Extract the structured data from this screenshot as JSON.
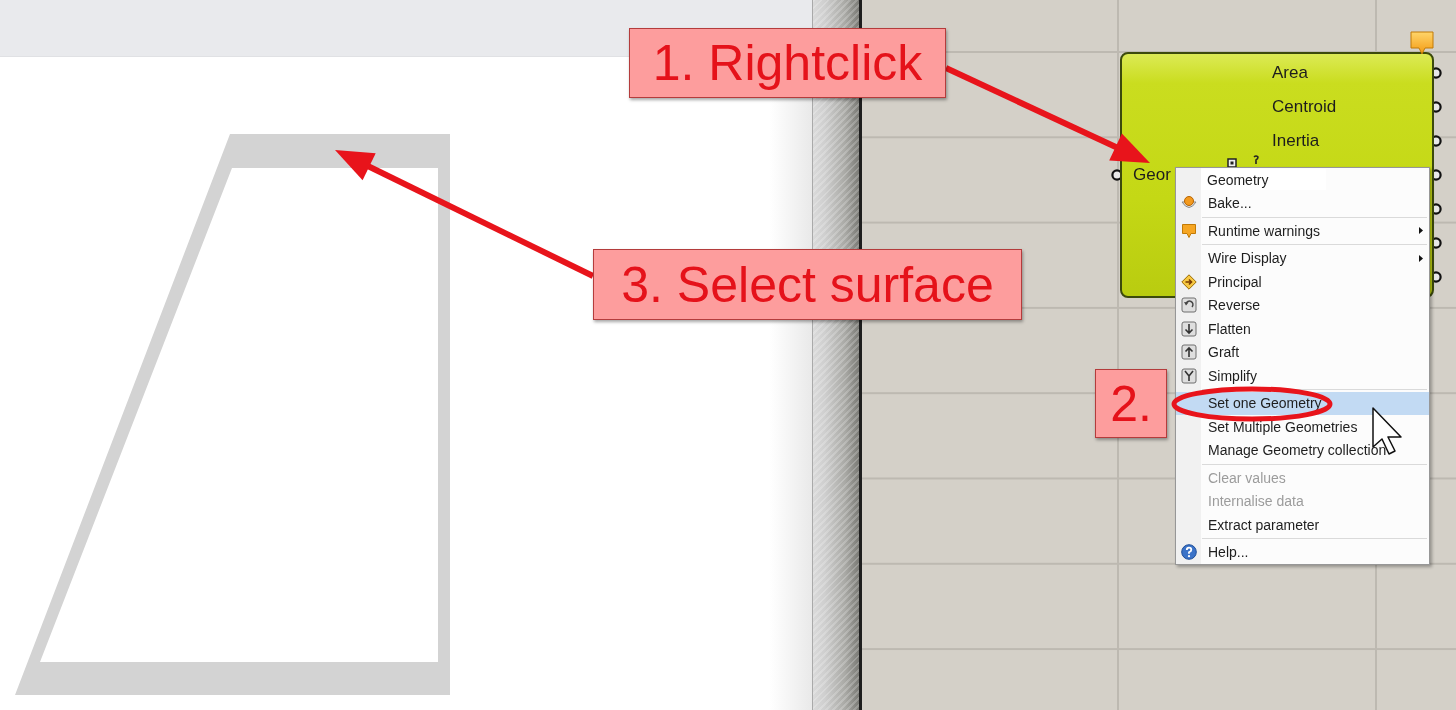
{
  "component": {
    "has_warning": true,
    "input": "Geor",
    "outputs": [
      "Area",
      "Centroid",
      "Inertia"
    ]
  },
  "context_menu": {
    "name_field": {
      "value": "Geometry"
    },
    "sections": [
      [
        {
          "label": "Bake...",
          "selected": false,
          "disabled": false,
          "submenu": false
        }
      ],
      [
        {
          "label": "Runtime warnings",
          "selected": false,
          "disabled": false,
          "submenu": true
        }
      ],
      [
        {
          "label": "Wire Display",
          "selected": false,
          "disabled": false,
          "submenu": true
        },
        {
          "label": "Principal",
          "selected": false,
          "disabled": false,
          "submenu": false
        },
        {
          "label": "Reverse",
          "selected": false,
          "disabled": false,
          "submenu": false
        },
        {
          "label": "Flatten",
          "selected": false,
          "disabled": false,
          "submenu": false
        },
        {
          "label": "Graft",
          "selected": false,
          "disabled": false,
          "submenu": false
        },
        {
          "label": "Simplify",
          "selected": false,
          "disabled": false,
          "submenu": false
        }
      ],
      [
        {
          "label": "Set one Geometry",
          "selected": true,
          "disabled": false,
          "submenu": false
        },
        {
          "label": "Set Multiple Geometries",
          "selected": false,
          "disabled": false,
          "submenu": false
        },
        {
          "label": "Manage Geometry collection",
          "selected": false,
          "disabled": false,
          "submenu": false
        }
      ],
      [
        {
          "label": "Clear values",
          "selected": false,
          "disabled": true,
          "submenu": false
        },
        {
          "label": "Internalise data",
          "selected": false,
          "disabled": true,
          "submenu": false
        },
        {
          "label": "Extract parameter",
          "selected": false,
          "disabled": false,
          "submenu": false
        }
      ],
      [
        {
          "label": "Help...",
          "selected": false,
          "disabled": false,
          "submenu": false
        }
      ]
    ]
  },
  "annotations": [
    {
      "label": "1. Rightclick"
    },
    {
      "label": "2."
    },
    {
      "label": "3. Select surface"
    }
  ]
}
